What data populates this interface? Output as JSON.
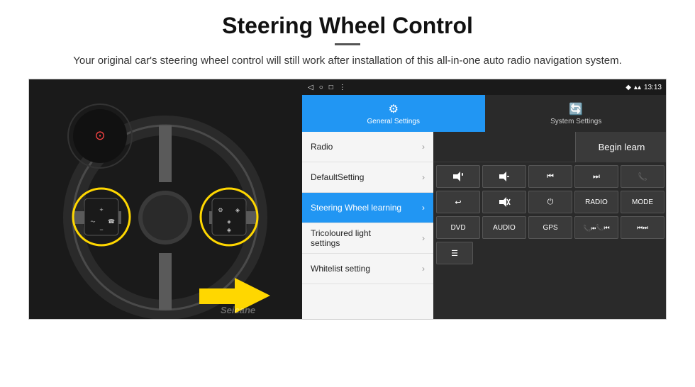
{
  "header": {
    "title": "Steering Wheel Control",
    "divider": true,
    "subtitle": "Your original car's steering wheel control will still work after installation of this all-in-one auto radio navigation system."
  },
  "tablet": {
    "status_bar": {
      "back": "◁",
      "circle": "○",
      "square": "□",
      "menu": "⋮",
      "location": "♦",
      "wifi": "▲",
      "time": "13:13"
    },
    "tabs": [
      {
        "label": "General Settings",
        "active": true
      },
      {
        "label": "System Settings",
        "active": false
      }
    ],
    "menu_items": [
      {
        "label": "Radio",
        "active": false
      },
      {
        "label": "DefaultSetting",
        "active": false
      },
      {
        "label": "Steering Wheel learning",
        "active": true
      },
      {
        "label": "Tricoloured light settings",
        "active": false
      },
      {
        "label": "Whitelist setting",
        "active": false
      }
    ],
    "begin_learn_label": "Begin learn",
    "control_buttons_row1": [
      "🔊+",
      "🔊−",
      "⏮",
      "⏭",
      "📞"
    ],
    "control_buttons_row2": [
      "↩",
      "🔇",
      "⏻",
      "RADIO",
      "MODE"
    ],
    "control_buttons_row3": [
      "DVD",
      "AUDIO",
      "GPS",
      "📞⏮",
      "⏮⏭"
    ],
    "control_buttons_row4": [
      "☰"
    ]
  }
}
